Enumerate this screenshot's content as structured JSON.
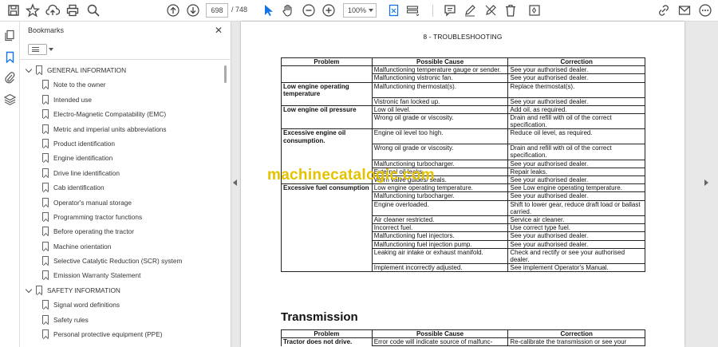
{
  "toolbar": {
    "page_current": "698",
    "page_total": "/ 748",
    "zoom": "100%"
  },
  "bookmarks": {
    "title": "Bookmarks",
    "items": [
      {
        "label": "GENERAL INFORMATION",
        "level": "top"
      },
      {
        "label": "Note to the owner",
        "level": "sub"
      },
      {
        "label": "Intended use",
        "level": "sub"
      },
      {
        "label": "Electro-Magnetic Compatability (EMC)",
        "level": "sub"
      },
      {
        "label": "Metric and imperial units abbreviations",
        "level": "sub"
      },
      {
        "label": "Product identification",
        "level": "sub"
      },
      {
        "label": "Engine identification",
        "level": "sub"
      },
      {
        "label": "Drive line identification",
        "level": "sub"
      },
      {
        "label": "Cab identification",
        "level": "sub"
      },
      {
        "label": "Operator's manual storage",
        "level": "sub"
      },
      {
        "label": "Programming tractor functions",
        "level": "sub"
      },
      {
        "label": "Before operating the tractor",
        "level": "sub"
      },
      {
        "label": "Machine orientation",
        "level": "sub"
      },
      {
        "label": "Selective Catalytic Reduction (SCR) system",
        "level": "sub"
      },
      {
        "label": "Emission Warranty Statement",
        "level": "sub"
      },
      {
        "label": "SAFETY INFORMATION",
        "level": "top"
      },
      {
        "label": "Signal word definitions",
        "level": "sub"
      },
      {
        "label": "Safety rules",
        "level": "sub"
      },
      {
        "label": "Personal protective equipment (PPE)",
        "level": "sub"
      }
    ]
  },
  "document": {
    "header": "8 - TROUBLESHOOTING",
    "columns": [
      "Problem",
      "Possible Cause",
      "Correction"
    ],
    "rows": [
      {
        "problem": "",
        "cause": "Malfunctioning temperature gauge or sender.",
        "correction": "See your authorised dealer."
      },
      {
        "problem": "",
        "cause": "Malfunctioning vistronic fan.",
        "correction": "See your authorised dealer.",
        "end": true
      },
      {
        "problem": "Low engine operating temperature",
        "cause": "Malfunctioning thermostat(s).",
        "correction": "Replace thermostat(s)."
      },
      {
        "problem": "",
        "cause": "Vistronic fan locked up.",
        "correction": "See your authorised dealer.",
        "end": true
      },
      {
        "problem": "Low engine oil pressure",
        "cause": "Low oil level.",
        "correction": "Add oil, as required."
      },
      {
        "problem": "",
        "cause": "Wrong oil grade or viscosity.",
        "correction": "Drain and refill with oil of the correct specification.",
        "end": true
      },
      {
        "problem": "Excessive engine oil consumption.",
        "cause": "Engine oil level too high.",
        "correction": "Reduce oil level, as required."
      },
      {
        "problem": "",
        "cause": "Wrong oil grade or viscosity.",
        "correction": "Drain and refill with oil of the correct specification."
      },
      {
        "problem": "",
        "cause": "Malfunctioning turbocharger.",
        "correction": "See your authorised dealer."
      },
      {
        "problem": "",
        "cause": "External oil leaks.",
        "correction": "Repair leaks."
      },
      {
        "problem": "",
        "cause": "Worn valve guides/ seals.",
        "correction": "See your authorised dealer.",
        "end": true
      },
      {
        "problem": "Excessive fuel consumption",
        "cause": "Low engine operating temperature.",
        "correction": "See Low engine operating temperature."
      },
      {
        "problem": "",
        "cause": "Malfunctioning turbocharger.",
        "correction": "See your authorised dealer."
      },
      {
        "problem": "",
        "cause": "Engine overloaded.",
        "correction": "Shift to lower gear, reduce draft load or ballast carried."
      },
      {
        "problem": "",
        "cause": "Air cleaner restricted.",
        "correction": "Service air cleaner."
      },
      {
        "problem": "",
        "cause": "Incorrect fuel.",
        "correction": "Use correct type fuel."
      },
      {
        "problem": "",
        "cause": "Malfunctioning fuel injectors.",
        "correction": "See your authorised dealer."
      },
      {
        "problem": "",
        "cause": "Malfunctioning fuel injection pump.",
        "correction": "See your authorised dealer."
      },
      {
        "problem": "",
        "cause": "Leaking air intake or exhaust manifold.",
        "correction": "Check and rectify or see your authorised dealer."
      },
      {
        "problem": "",
        "cause": "Implement incorrectly adjusted.",
        "correction": "See implement Operator's Manual.",
        "end": true
      }
    ],
    "watermark": "machinecatalogic.com",
    "section_title": "Transmission",
    "trans_columns": [
      "Problem",
      "Possible Cause",
      "Correction"
    ],
    "trans_rows": [
      {
        "problem": "Tractor does not drive.",
        "cause": "Error code will indicate source of malfunc-",
        "correction": "Re-calibrate the transmission or see your"
      }
    ]
  }
}
